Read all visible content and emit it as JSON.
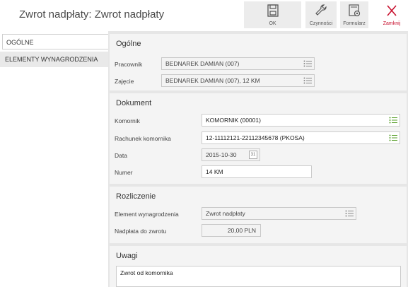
{
  "window": {
    "title": "Zwrot nadpłaty: Zwrot nadpłaty"
  },
  "toolbar": {
    "ok_label": "OK",
    "czynnosci_label": "Czynności",
    "formularz_label": "Formularz",
    "zamknij_label": "Zamknij"
  },
  "nav": {
    "items": [
      {
        "label": "OGÓLNE"
      },
      {
        "label": "ELEMENTY WYNAGRODZENIA"
      }
    ]
  },
  "ogolne": {
    "title": "Ogólne",
    "pracownik_label": "Pracownik",
    "pracownik_value": "BEDNAREK DAMIAN (007)",
    "zajecie_label": "Zajęcie",
    "zajecie_value": "BEDNAREK DAMIAN (007), 12 KM"
  },
  "dokument": {
    "title": "Dokument",
    "komornik_label": "Komornik",
    "komornik_value": "KOMORNIK (00001)",
    "rachunek_label": "Rachunek komornika",
    "rachunek_value": "12-11112121-22112345678 (PKOSA)",
    "data_label": "Data",
    "data_value": "2015-10-30",
    "calendar_day": "31",
    "numer_label": "Numer",
    "numer_value": "14 KM"
  },
  "rozliczenie": {
    "title": "Rozliczenie",
    "element_label": "Element wynagrodzenia",
    "element_value": "Zwrot nadpłaty",
    "naplata_label": "Nadpłata do zwrotu",
    "naplata_value": "20,00 PLN"
  },
  "uwagi": {
    "title": "Uwagi",
    "value": "Zwrot od komornika"
  },
  "colors": {
    "accent_green": "#5aa02c",
    "close_red": "#c8102e"
  }
}
